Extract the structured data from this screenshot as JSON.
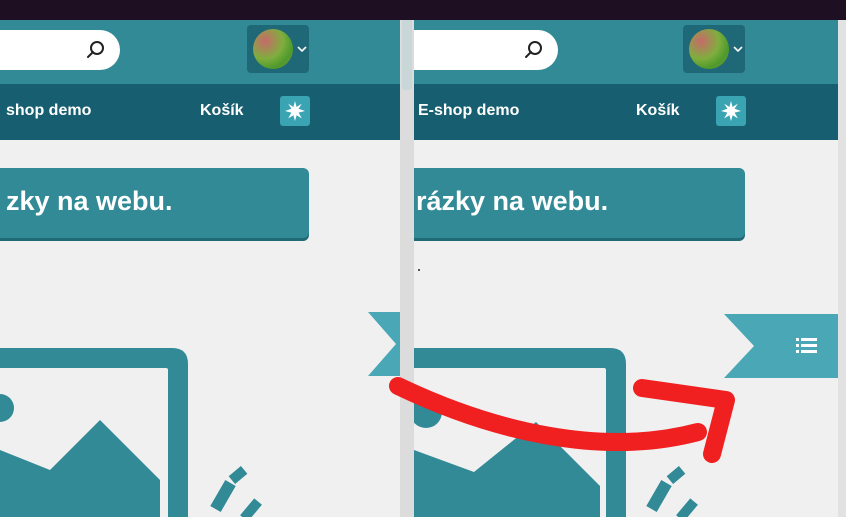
{
  "panels": [
    {
      "nav": {
        "shop_label": "shop demo",
        "cart_label": "Košík"
      },
      "banner": {
        "text": "zky na webu."
      }
    },
    {
      "nav": {
        "shop_label": "E-shop demo",
        "cart_label": "Košík"
      },
      "banner": {
        "text": "rázky na webu."
      }
    }
  ],
  "icons": {
    "search": "search-icon",
    "avatar": "user-avatar",
    "dropdown": "chevron-down-icon",
    "theme": "sun-icon",
    "menu": "list-icon",
    "annotation": "red-curved-arrow"
  },
  "colors": {
    "header": "#318a96",
    "nav": "#175f70",
    "accent": "#3aa4b3",
    "ribbon": "#4aa8b6",
    "annotation_arrow": "#f02020"
  }
}
